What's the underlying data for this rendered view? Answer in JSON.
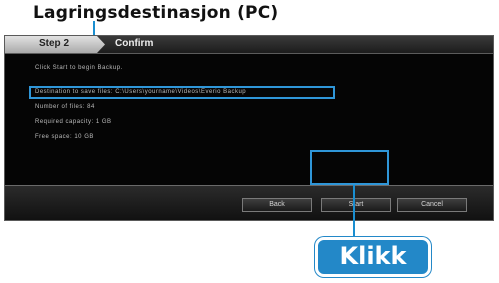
{
  "callout": {
    "title": "Lagringsdestinasjon (PC)",
    "action": "Klikk"
  },
  "dialog": {
    "step": "Step 2",
    "title": "Confirm",
    "intro": "Click Start to begin Backup.",
    "destination": "Destination to save files: C:\\Users\\yourname\\Videos\\Everio Backup",
    "lines": [
      "Number of files: 84",
      "Required capacity: 1 GB",
      "Free space: 10 GB"
    ]
  },
  "buttons": {
    "back": "Back",
    "start": "Start",
    "cancel": "Cancel"
  },
  "colors": {
    "accent": "#2388c8",
    "highlight": "#2f96d8",
    "dialog_bg": "#050505"
  }
}
